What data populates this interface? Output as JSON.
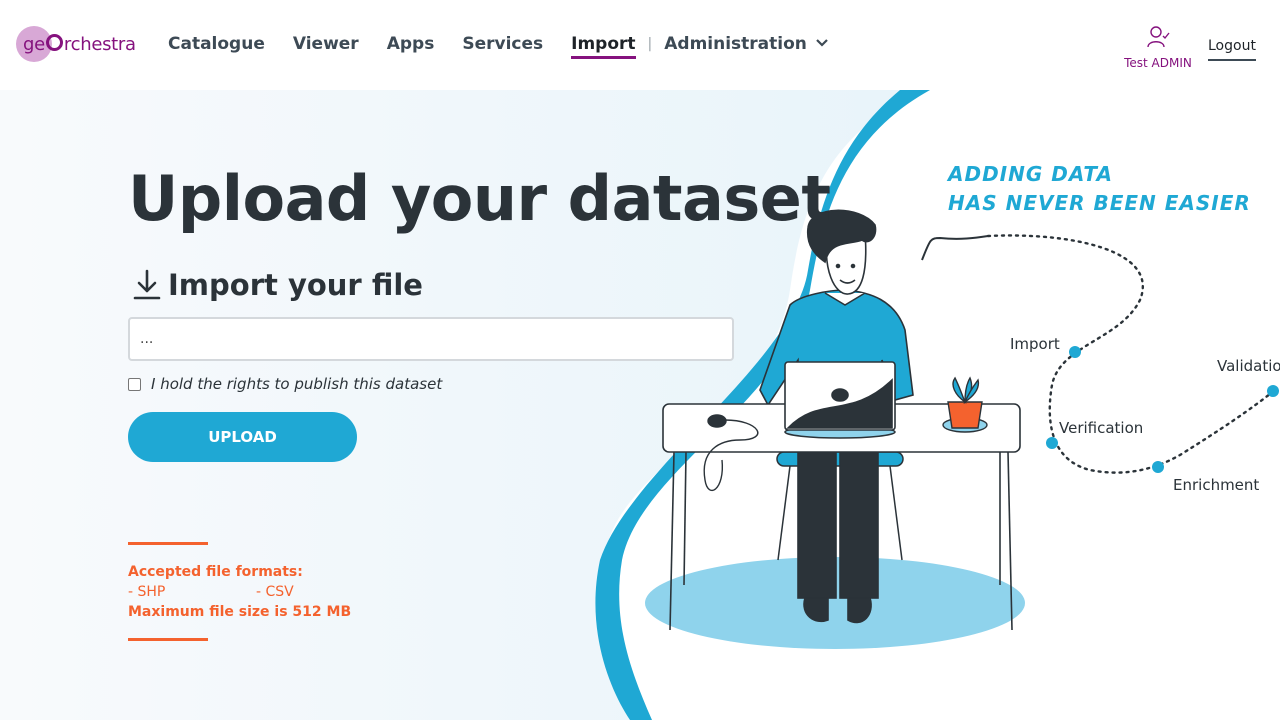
{
  "header": {
    "logo_text_pre": "ge",
    "logo_text_post": "rchestra",
    "nav": [
      "Catalogue",
      "Viewer",
      "Apps",
      "Services"
    ],
    "nav_active": "Import",
    "nav_separator": "|",
    "admin_label": "Administration",
    "user_name": "Test ADMIN",
    "logout_label": "Logout"
  },
  "main": {
    "title": "Upload your dataset",
    "subtitle": "Import your file",
    "file_input_value": "...",
    "rights_label": "I hold the rights to publish this dataset",
    "upload_label": "UPLOAD",
    "formats_heading": "Accepted file formats:",
    "formats": [
      "- SHP",
      "- CSV"
    ],
    "max_size": "Maximum file size is 512 MB"
  },
  "illustration": {
    "tagline_line1": "ADDING DATA",
    "tagline_line2": "HAS NEVER BEEN EASIER",
    "steps": [
      "Import",
      "Verification",
      "Enrichment",
      "Validation"
    ]
  },
  "colors": {
    "brand_purple": "#85127e",
    "accent_blue": "#1fa8d4",
    "accent_orange": "#f4622e",
    "text_dark": "#2b3339"
  }
}
